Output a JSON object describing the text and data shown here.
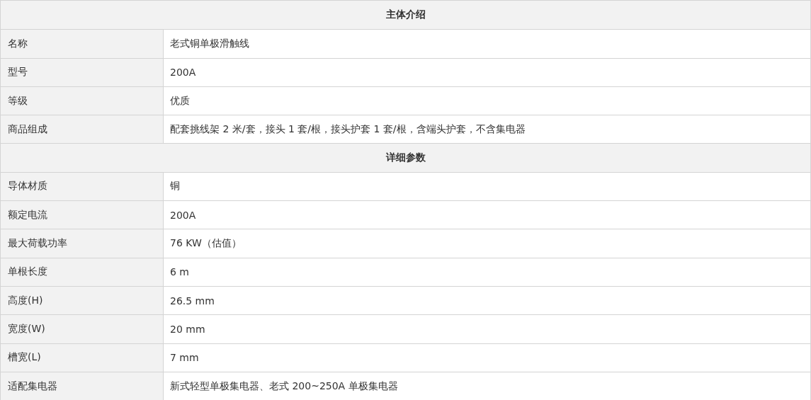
{
  "sections": [
    {
      "title": "主体介绍",
      "rows": [
        {
          "label": "名称",
          "value": "老式铜单极滑触线"
        },
        {
          "label": "型号",
          "value": "200A"
        },
        {
          "label": "等级",
          "value": "优质"
        },
        {
          "label": "商品组成",
          "value": "配套挑线架 2 米/套，接头 1 套/根，接头护套 1 套/根，含端头护套，不含集电器"
        }
      ]
    },
    {
      "title": "详细参数",
      "rows": [
        {
          "label": "导体材质",
          "value": "铜"
        },
        {
          "label": "额定电流",
          "value": "200A"
        },
        {
          "label": "最大荷载功率",
          "value": "76 KW（估值）"
        },
        {
          "label": "单根长度",
          "value": "6 m"
        },
        {
          "label": "高度(H)",
          "value": "26.5 mm"
        },
        {
          "label": "宽度(W)",
          "value": "20 mm"
        },
        {
          "label": "槽宽(L)",
          "value": "7 mm"
        },
        {
          "label": "适配集电器",
          "value": "新式轻型单极集电器、老式 200~250A 单极集电器"
        }
      ]
    }
  ]
}
